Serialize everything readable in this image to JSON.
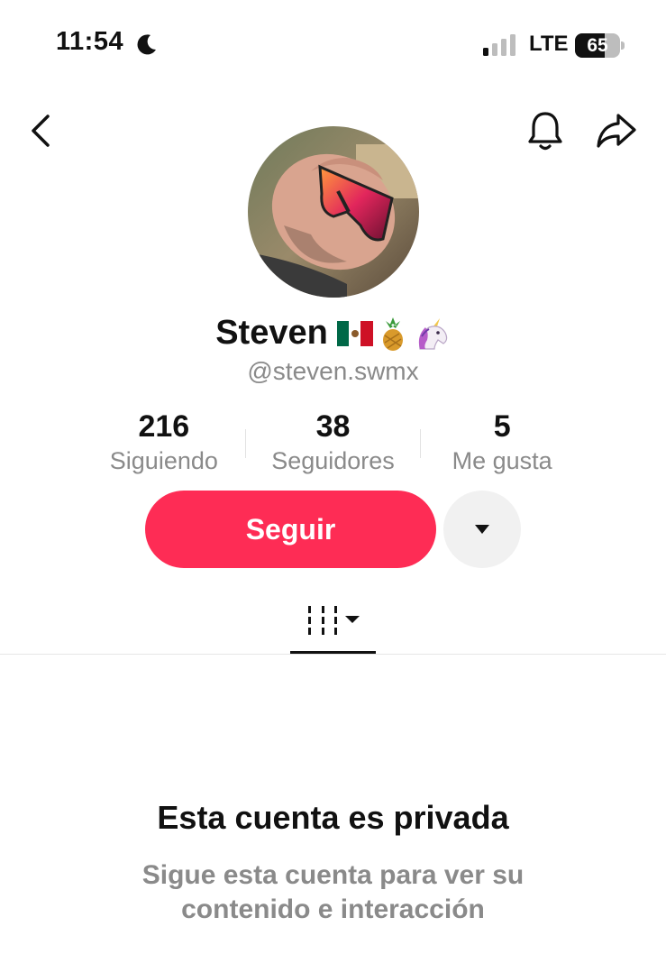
{
  "status_bar": {
    "time": "11:54",
    "network": "LTE",
    "battery": "65",
    "battery_level": 0.65,
    "icons": [
      "moon-icon",
      "signal-icon",
      "battery-icon"
    ]
  },
  "nav": {
    "icons": [
      "back-chevron-icon",
      "bell-icon",
      "share-arrow-icon"
    ]
  },
  "profile": {
    "display_name": "Steven",
    "name_emojis": [
      "🇲🇽",
      "🍍",
      "🦄"
    ],
    "username": "@steven.swmx"
  },
  "stats": [
    {
      "value": "216",
      "label": "Siguiendo"
    },
    {
      "value": "38",
      "label": "Seguidores"
    },
    {
      "value": "5",
      "label": "Me gusta"
    }
  ],
  "actions": {
    "follow_label": "Seguir",
    "more_icon": "caret-down-icon"
  },
  "tabs": {
    "active_icon": "grid-videos-icon"
  },
  "private": {
    "title": "Esta cuenta es privada",
    "subtitle": "Sigue esta cuenta para ver su contenido e interacción"
  },
  "colors": {
    "accent": "#fe2c55",
    "secondary_text": "#8a8a8a",
    "primary_text": "#111111"
  }
}
